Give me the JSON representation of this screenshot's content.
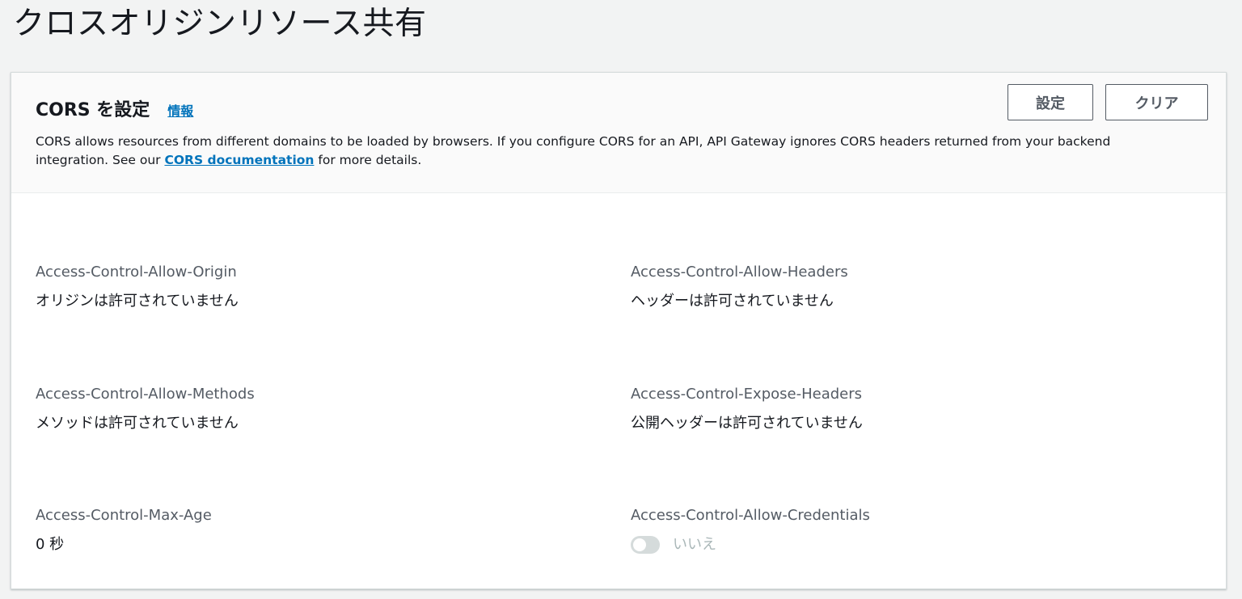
{
  "page": {
    "title": "クロスオリジンリソース共有"
  },
  "panel": {
    "title": "CORS を設定",
    "info_link": "情報",
    "description_prefix": "CORS allows resources from different domains to be loaded by browsers. If you configure CORS for an API, API Gateway ignores CORS headers returned from your backend integration. See our ",
    "description_link": "CORS documentation",
    "description_suffix": " for more details.",
    "configure_button": "設定",
    "clear_button": "クリア"
  },
  "fields": {
    "allow_origin": {
      "label": "Access-Control-Allow-Origin",
      "value": "オリジンは許可されていません"
    },
    "allow_headers": {
      "label": "Access-Control-Allow-Headers",
      "value": "ヘッダーは許可されていません"
    },
    "allow_methods": {
      "label": "Access-Control-Allow-Methods",
      "value": "メソッドは許可されていません"
    },
    "expose_headers": {
      "label": "Access-Control-Expose-Headers",
      "value": "公開ヘッダーは許可されていません"
    },
    "max_age": {
      "label": "Access-Control-Max-Age",
      "value": "0 秒"
    },
    "allow_credentials": {
      "label": "Access-Control-Allow-Credentials",
      "value": "いいえ",
      "enabled": false
    }
  },
  "colors": {
    "link": "#0073bb",
    "toggle_off": "#d5dbdb",
    "button_border": "#545b64"
  },
  "icons": {
    "credentials_toggle": "toggle-switch-icon"
  }
}
